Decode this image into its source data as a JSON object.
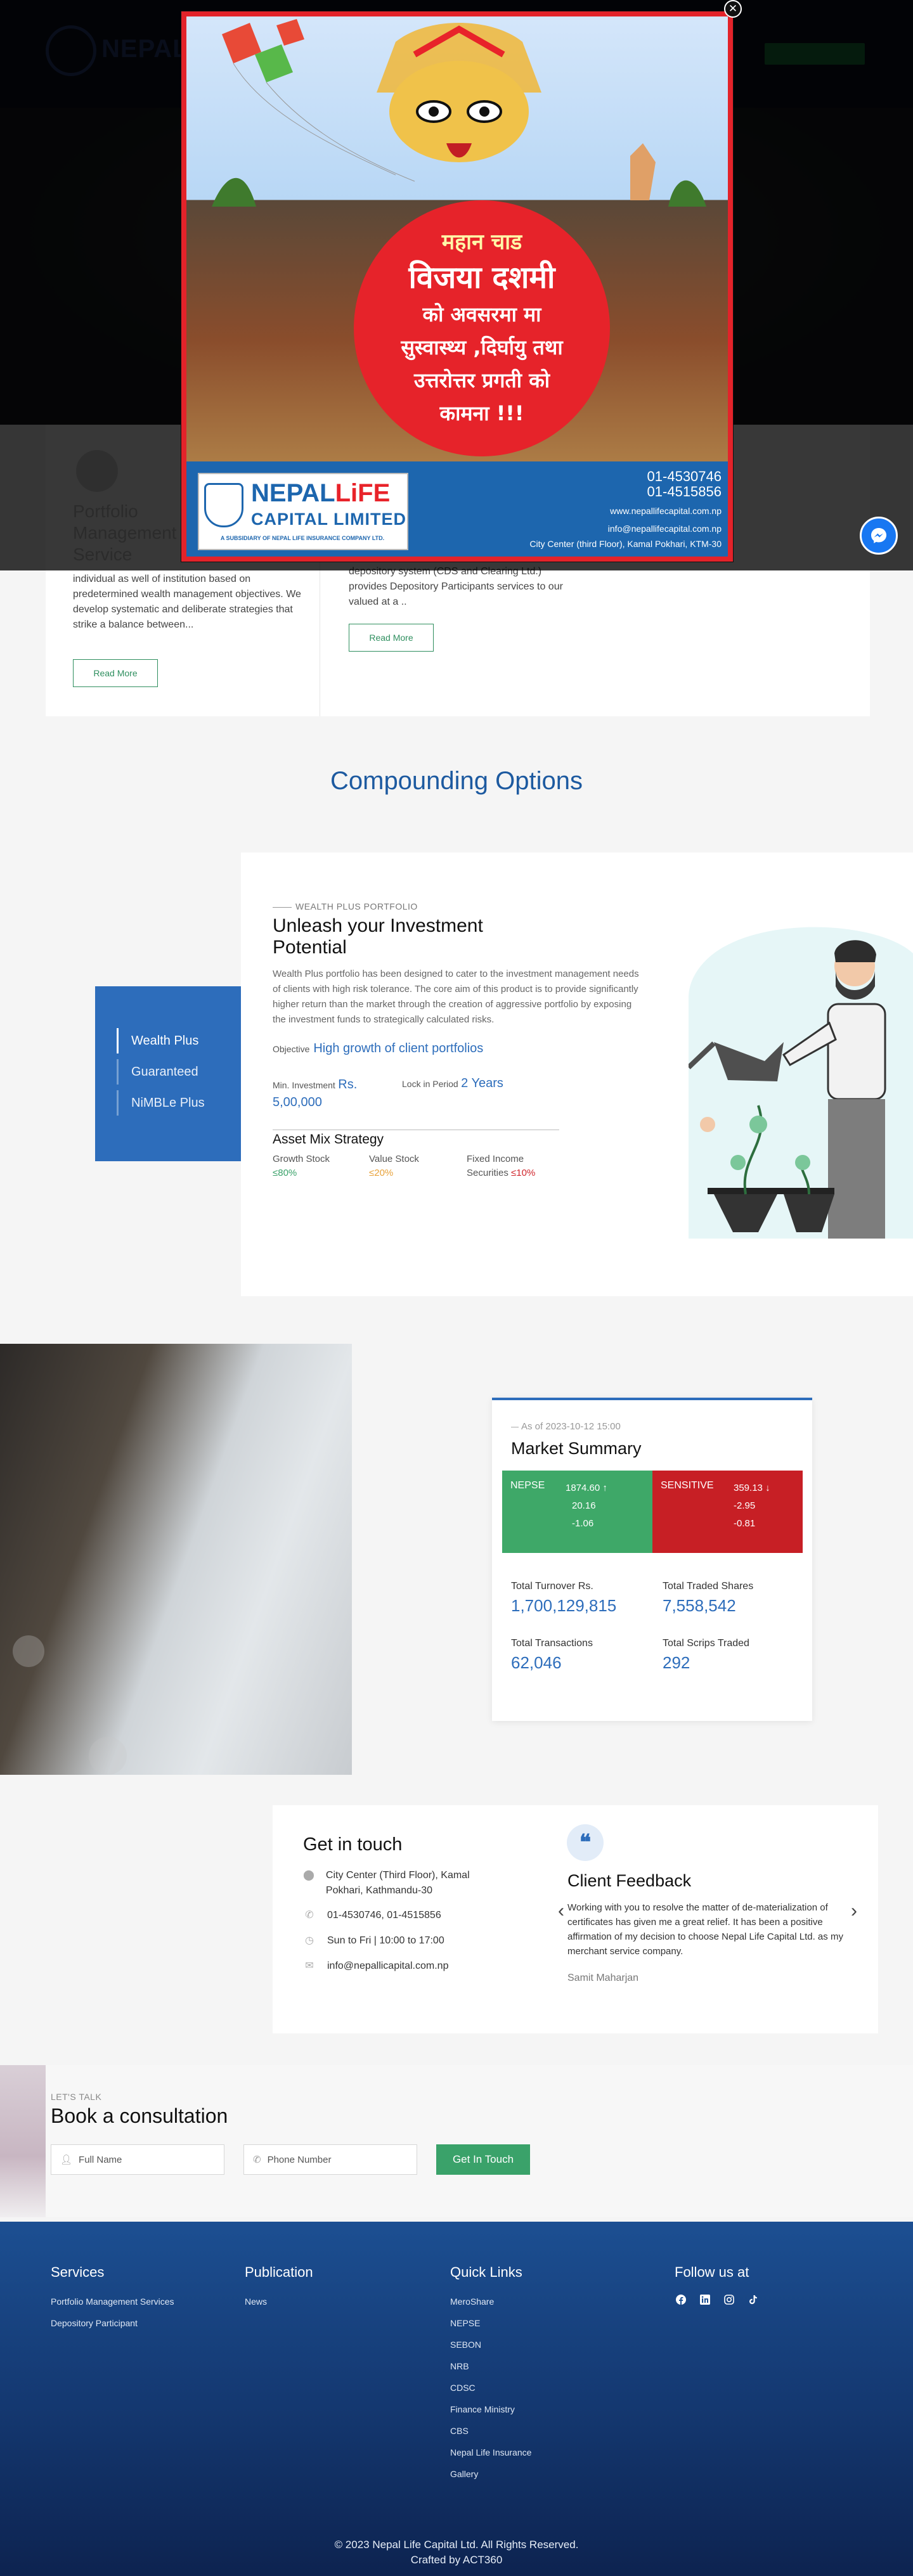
{
  "services": {
    "left_text": "individual as well of institution based on predetermined wealth management objectives. We develop systematic and deliberate strategies that strike a balance between...",
    "right_text": "depository system (CDS and Clearing Ltd.) provides Depository Participants services to our valued at a ..",
    "read_more": "Read More"
  },
  "compounding": {
    "title": "Compounding Options",
    "tabs": [
      "Wealth Plus",
      "Guaranteed",
      "NiMBLe Plus"
    ],
    "eyebrow": "WEALTH PLUS PORTFOLIO",
    "heading": "Unleash your Investment Potential",
    "description": "Wealth Plus portfolio has been designed to cater to the investment management needs of clients with high risk tolerance. The core aim of this product is to provide significantly higher return than the market through the creation of aggressive portfolio by exposing the investment funds to strategically calculated risks.",
    "objective_label": "Objective",
    "objective_value": "High growth of client portfolios",
    "min_investment_label": "Min. Investment",
    "min_investment_value": "Rs. 5,00,000",
    "lock_label": "Lock in Period",
    "lock_value": "2 Years",
    "mix_title": "Asset Mix Strategy",
    "mix": [
      {
        "label": "Growth Stock",
        "value": "≤80%",
        "color": "#3aa26a"
      },
      {
        "label": "Value Stock",
        "value": "≤20%",
        "color": "#e8a23a"
      },
      {
        "label": "Fixed Income Securities",
        "value": "≤10%",
        "color": "#d0262d"
      }
    ]
  },
  "market": {
    "as_of": "As of 2023-10-12 15:00",
    "title": "Market Summary",
    "nepse": {
      "name": "NEPSE",
      "value": "1874.60",
      "change": "20.16",
      "pct": "-1.06",
      "color": "#3ea868"
    },
    "sensitive": {
      "name": "SENSITIVE",
      "value": "359.13",
      "change": "-2.95",
      "pct": "-0.81",
      "color": "#c71f25"
    },
    "turnover_label": "Total Turnover Rs.",
    "turnover_value": "1,700,129,815",
    "shares_label": "Total Traded Shares",
    "shares_value": "7,558,542",
    "transactions_label": "Total Transactions",
    "transactions_value": "62,046",
    "scrips_label": "Total Scrips Traded",
    "scrips_value": "292"
  },
  "contact": {
    "title": "Get in touch",
    "address": "City Center (Third Floor), Kamal Pokhari, Kathmandu-30",
    "phone": "01-4530746, 01-4515856",
    "hours": "Sun to Fri | 10:00 to 17:00",
    "email": "info@nepallicapital.com.np"
  },
  "feedback": {
    "title": "Client Feedback",
    "text": "Working with you to resolve the matter of de-materialization of certificates has given me a great relief. It has been a positive affirmation of my decision to choose Nepal Life Capital Ltd. as my merchant service company.",
    "author": "Samit Maharjan"
  },
  "consultation": {
    "eyebrow": "LET'S TALK",
    "title": "Book a consultation",
    "name_placeholder": "Full Name",
    "phone_placeholder": "Phone Number",
    "button": "Get In Touch"
  },
  "footer": {
    "services_title": "Services",
    "services": [
      "Portfolio Management Services",
      "Depository Participant"
    ],
    "publication_title": "Publication",
    "publication": [
      "News"
    ],
    "quick_title": "Quick Links",
    "quick": [
      "MeroShare",
      "NEPSE",
      "SEBON",
      "NRB",
      "CDSC",
      "Finance Ministry",
      "CBS",
      "Nepal Life Insurance",
      "Gallery"
    ],
    "follow_title": "Follow us at",
    "copyright": "© 2023 Nepal Life Capital Ltd. All Rights Reserved.",
    "crafted": "Crafted by ACT360"
  },
  "popup": {
    "line1": "महान चाड",
    "line2": "विजया दशमी",
    "line3": "को अवसरमा मा",
    "line4": "सुस्वास्थ्य ,दिर्घायु तथा",
    "line5": "उत्तरोत्तर प्रगती को",
    "line6": "कामना !!!",
    "phone1": "01-4530746",
    "phone2": "01-4515856",
    "website": "www.nepallifecapital.com.np",
    "email": "info@nepallifecapital.com.np",
    "address": "City Center (third Floor), Kamal Pokhari, KTM-30",
    "logo_word1": "NEPAL",
    "logo_word2": "LiFE",
    "logo_line2": "CAPITAL LIMITED",
    "logo_sub": "A SUBSIDIARY OF NEPAL LIFE INSURANCE COMPANY LTD."
  }
}
